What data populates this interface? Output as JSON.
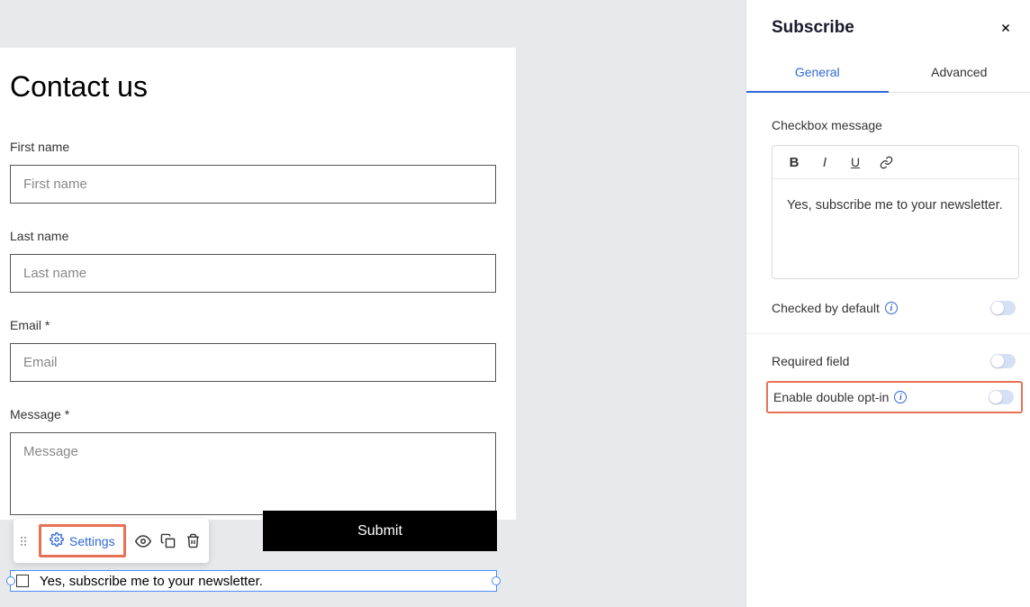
{
  "form": {
    "title": "Contact us",
    "fields": {
      "first_name": {
        "label": "First name",
        "placeholder": "First name"
      },
      "last_name": {
        "label": "Last name",
        "placeholder": "Last name"
      },
      "email": {
        "label": "Email *",
        "placeholder": "Email"
      },
      "message": {
        "label": "Message *",
        "placeholder": "Message"
      }
    },
    "submit_label": "Submit",
    "subscribe_checkbox_text": "Yes, subscribe me to your newsletter."
  },
  "toolbar": {
    "settings_label": "Settings"
  },
  "panel": {
    "title": "Subscribe",
    "tabs": {
      "general": "General",
      "advanced": "Advanced"
    },
    "checkbox_message_label": "Checkbox message",
    "editor_content": "Yes, subscribe me to your newsletter.",
    "checked_by_default_label": "Checked by default",
    "required_field_label": "Required field",
    "double_opt_in_label": "Enable double opt-in"
  }
}
